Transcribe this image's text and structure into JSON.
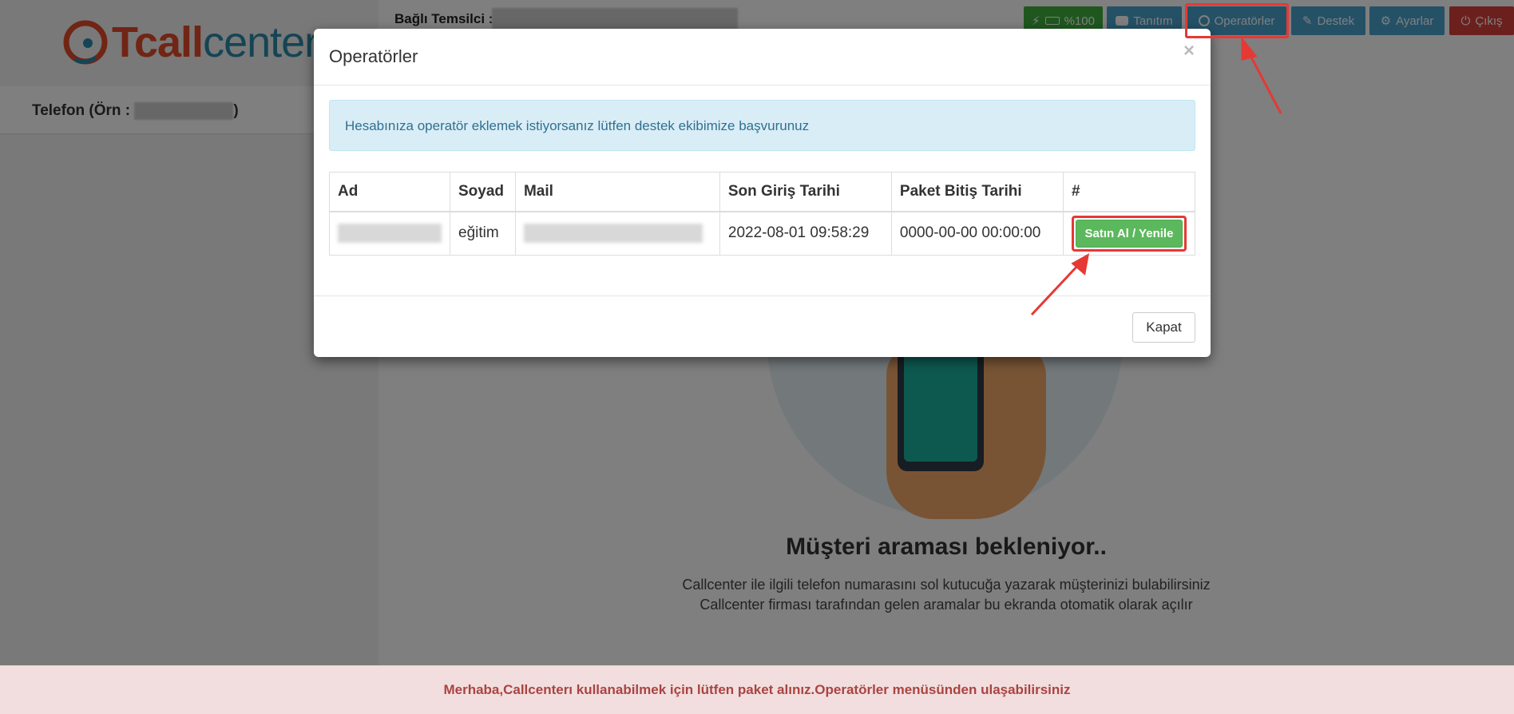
{
  "logo": {
    "part_t": "T",
    "part_call": "call",
    "part_center": "center"
  },
  "sidebar": {
    "phone_label_prefix": "Telefon (Örn : ",
    "phone_label_suffix": ")"
  },
  "topbar": {
    "rep_label": "Bağlı Temsilci :",
    "battery": "%100",
    "tanitim": "Tanıtım",
    "operatorler": "Operatörler",
    "destek": "Destek",
    "ayarlar": "Ayarlar",
    "cikis": "Çıkış"
  },
  "hero": {
    "title": "Müşteri araması bekleniyor..",
    "line1": "Callcenter ile ilgili telefon numarasını sol kutucuğa yazarak müşterinizi bulabilirsiniz",
    "line2": "Callcenter firması tarafından gelen aramalar bu ekranda otomatik olarak açılır"
  },
  "modal": {
    "title": "Operatörler",
    "close": "×",
    "info": "Hesabınıza operatör eklemek istiyorsanız lütfen destek ekibimize başvurunuz",
    "columns": [
      "Ad",
      "Soyad",
      "Mail",
      "Son Giriş Tarihi",
      "Paket Bitiş Tarihi",
      "#"
    ],
    "rows": [
      {
        "soyad": "eğitim",
        "son_giris": "2022-08-01 09:58:29",
        "paket_bitis": "0000-00-00 00:00:00",
        "action": "Satın Al / Yenile"
      }
    ],
    "close_button": "Kapat"
  },
  "footer_alert": "Merhaba,Callcenterı kullanabilmek için lütfen paket alınız.Operatörler menüsünden ulaşabilirsiniz",
  "colors": {
    "accent_blue": "#4aa3cf",
    "success": "#5cb85c",
    "danger": "#d9413a",
    "annotation": "#e53935"
  }
}
